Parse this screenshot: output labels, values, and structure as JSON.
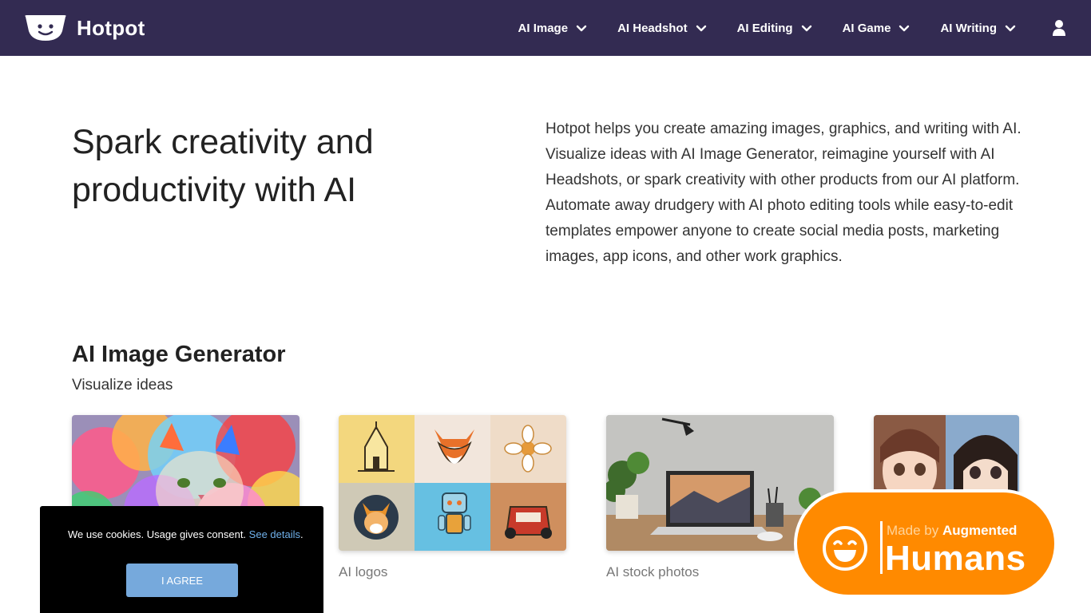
{
  "nav": {
    "brand": "Hotpot",
    "items": [
      {
        "label": "AI Image"
      },
      {
        "label": "AI Headshot"
      },
      {
        "label": "AI Editing"
      },
      {
        "label": "AI Game"
      },
      {
        "label": "AI Writing"
      }
    ],
    "icons": {
      "logo": "hotpot-face-logo",
      "chevron": "chevron-down-icon",
      "user": "user-icon"
    },
    "bg_color": "#332b52"
  },
  "hero": {
    "title": "Spark creativity and productivity with AI",
    "description": "Hotpot helps you create amazing images, graphics, and writing with AI. Visualize ideas with AI Image Generator, reimagine yourself with AI Headshots, or spark creativity with other products from our AI platform. Automate away drudgery with AI photo editing tools while easy-to-edit templates empower anyone to create social media posts, marketing images, app icons, and other work graphics."
  },
  "section": {
    "title": "AI Image Generator",
    "subtitle": "Visualize ideas",
    "cards": [
      {
        "label": "",
        "image": "colorful-cat-art"
      },
      {
        "label": "AI logos",
        "image": "logo-grid"
      },
      {
        "label": "AI stock photos",
        "image": "desk-laptop-photo"
      },
      {
        "label": "",
        "image": "anime-girls"
      }
    ]
  },
  "cookie": {
    "text": "We use cookies. Usage gives consent.",
    "link": "See details",
    "period": ".",
    "button": "I AGREE"
  },
  "badge": {
    "small_prefix": "Made by",
    "small_strong": "Augmented",
    "big": "Humans",
    "color": "#ff8a00"
  }
}
